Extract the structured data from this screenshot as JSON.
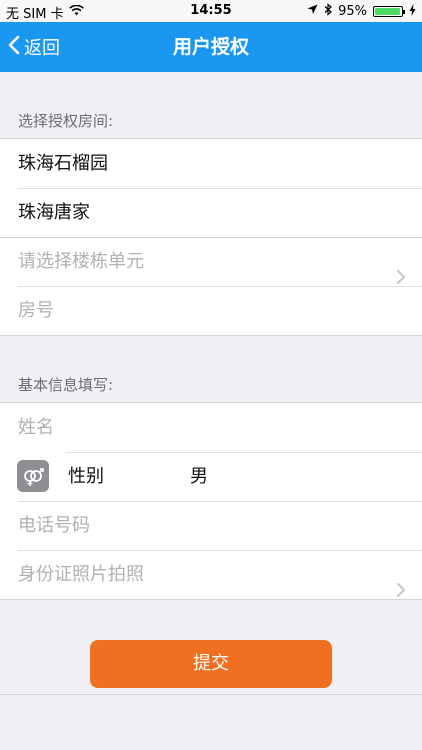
{
  "status_bar": {
    "carrier": "无 SIM 卡",
    "time": "14:55",
    "battery": "95%",
    "battery_level": 0.95
  },
  "nav": {
    "back_label": "返回",
    "title": "用户授权"
  },
  "room_section": {
    "header": "选择授权房间:",
    "items": [
      "珠海石榴园",
      "珠海唐家"
    ],
    "building_placeholder": "请选择楼栋单元",
    "room_placeholder": "房号"
  },
  "info_section": {
    "header": "基本信息填写:",
    "name_placeholder": "姓名",
    "gender_label": "性别",
    "gender_value": "男",
    "phone_placeholder": "电话号码",
    "id_photo_placeholder": "身份证照片拍照"
  },
  "submit_label": "提交",
  "colors": {
    "nav_bg": "#1a97f1",
    "submit_bg": "#f07022",
    "page_bg": "#efeff4"
  }
}
